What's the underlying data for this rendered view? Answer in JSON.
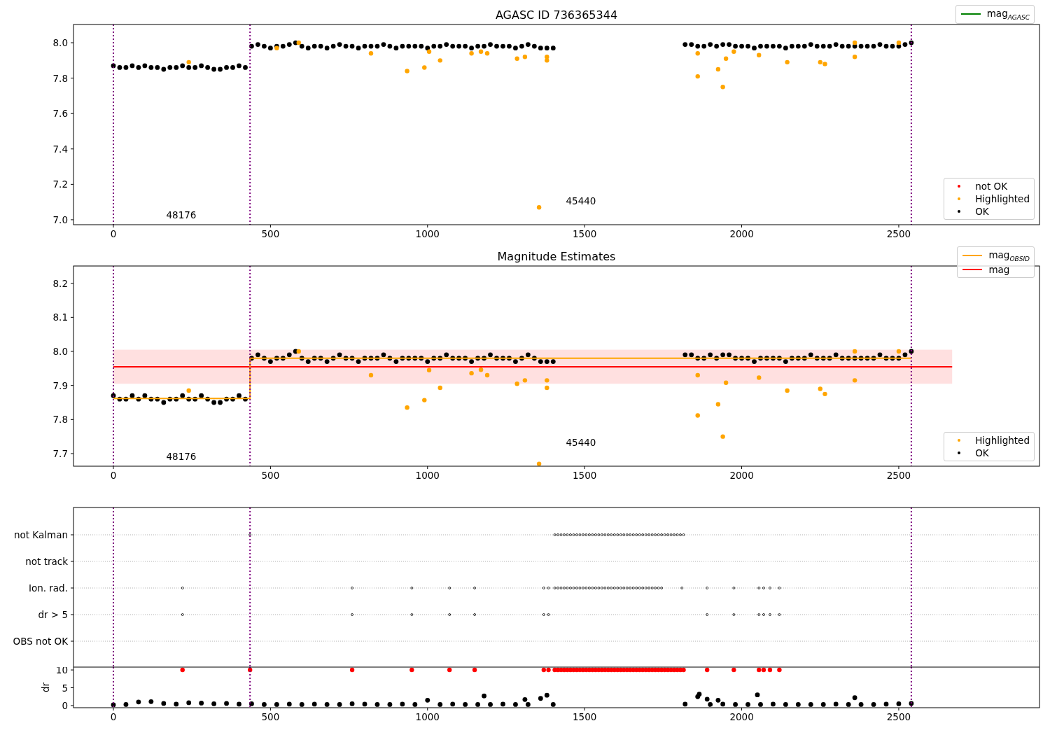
{
  "panels": [
    {
      "chart_data": {
        "type": "scatter",
        "title": "AGASC ID 736365344",
        "xlim": [
          -127,
          2948
        ],
        "ylim": [
          6.972,
          8.103
        ],
        "xticks": [
          0,
          500,
          1000,
          1500,
          2000,
          2500
        ],
        "yticks": [
          {
            "value": 7.0,
            "label": "7.0"
          },
          {
            "value": 7.2,
            "label": "7.2"
          },
          {
            "value": 7.4,
            "label": "7.4"
          },
          {
            "value": 7.6,
            "label": "7.6"
          },
          {
            "value": 7.8,
            "label": "7.8"
          },
          {
            "value": 8.0,
            "label": "8.0"
          }
        ],
        "series": [
          {
            "color": "#000000",
            "x": [
              0,
              20,
              40,
              60,
              80,
              100,
              120,
              140,
              160,
              180,
              200,
              220,
              240,
              260,
              280,
              300,
              320,
              340,
              360,
              380,
              400,
              420,
              440,
              460,
              480,
              500,
              520,
              540,
              560,
              580,
              600,
              620,
              640,
              660,
              680,
              700,
              720,
              740,
              760,
              780,
              800,
              820,
              840,
              860,
              880,
              900,
              920,
              940,
              960,
              980,
              1000,
              1020,
              1040,
              1060,
              1080,
              1100,
              1120,
              1140,
              1160,
              1180,
              1200,
              1220,
              1240,
              1260,
              1280,
              1300,
              1320,
              1340,
              1360,
              1380,
              1400,
              1820,
              1840,
              1860,
              1880,
              1900,
              1920,
              1940,
              1960,
              1980,
              2000,
              2020,
              2040,
              2060,
              2080,
              2100,
              2120,
              2140,
              2160,
              2180,
              2200,
              2220,
              2240,
              2260,
              2280,
              2300,
              2320,
              2340,
              2360,
              2380,
              2400,
              2420,
              2440,
              2460,
              2480,
              2500,
              2520,
              2540
            ],
            "values": [
              7.87,
              7.86,
              7.86,
              7.87,
              7.86,
              7.87,
              7.86,
              7.86,
              7.85,
              7.86,
              7.86,
              7.87,
              7.86,
              7.86,
              7.87,
              7.86,
              7.85,
              7.85,
              7.86,
              7.86,
              7.87,
              7.86,
              7.98,
              7.99,
              7.98,
              7.97,
              7.98,
              7.98,
              7.99,
              8.0,
              7.98,
              7.97,
              7.98,
              7.98,
              7.97,
              7.98,
              7.99,
              7.98,
              7.98,
              7.97,
              7.98,
              7.98,
              7.98,
              7.99,
              7.98,
              7.97,
              7.98,
              7.98,
              7.98,
              7.98,
              7.97,
              7.98,
              7.98,
              7.99,
              7.98,
              7.98,
              7.98,
              7.97,
              7.98,
              7.98,
              7.99,
              7.98,
              7.98,
              7.98,
              7.97,
              7.98,
              7.99,
              7.98,
              7.97,
              7.97,
              7.97,
              7.99,
              7.99,
              7.98,
              7.98,
              7.99,
              7.98,
              7.99,
              7.99,
              7.98,
              7.98,
              7.98,
              7.97,
              7.98,
              7.98,
              7.98,
              7.98,
              7.97,
              7.98,
              7.98,
              7.98,
              7.99,
              7.98,
              7.98,
              7.98,
              7.99,
              7.98,
              7.98,
              7.98,
              7.98,
              7.98,
              7.98,
              7.99,
              7.98,
              7.98,
              7.98,
              7.99,
              8.0
            ]
          },
          {
            "color": "#ffa500",
            "x": [
              240,
              520,
              590,
              820,
              935,
              990,
              1005,
              1040,
              1140,
              1170,
              1190,
              1285,
              1310,
              1355,
              1380,
              1380,
              1860,
              1860,
              1925,
              1940,
              1950,
              1975,
              2055,
              2145,
              2250,
              2265,
              2360,
              2360,
              2500
            ],
            "values": [
              7.89,
              7.97,
              8.0,
              7.94,
              7.84,
              7.86,
              7.95,
              7.9,
              7.94,
              7.95,
              7.94,
              7.91,
              7.92,
              7.07,
              7.9,
              7.92,
              7.81,
              7.94,
              7.85,
              7.75,
              7.91,
              7.95,
              7.93,
              7.89,
              7.89,
              7.88,
              7.92,
              8.0,
              8.0
            ]
          }
        ],
        "ref_lines": [
          {
            "axis": "x",
            "value": 0
          },
          {
            "axis": "x",
            "value": 435
          },
          {
            "axis": "x",
            "value": 2540
          }
        ],
        "annotations": [
          "48176",
          "45440"
        ]
      },
      "legends": [
        {
          "entries": [
            {
              "label": "mag$_{AGASC}$",
              "color": "#008000",
              "kind": "line"
            }
          ]
        },
        {
          "entries": [
            {
              "label": "not OK",
              "color": "#ff0000",
              "kind": "dot"
            },
            {
              "label": "Highlighted",
              "color": "#ffa500",
              "kind": "dot"
            },
            {
              "label": "OK",
              "color": "#000000",
              "kind": "dot"
            }
          ]
        }
      ]
    },
    {
      "chart_data": {
        "type": "scatter",
        "title": "Magnitude Estimates",
        "xlim": [
          -127,
          2948
        ],
        "ylim": [
          7.663,
          8.2507
        ],
        "xticks": [
          0,
          500,
          1000,
          1500,
          2000,
          2500
        ],
        "yticks": [
          {
            "value": 7.7,
            "label": "7.7"
          },
          {
            "value": 7.8,
            "label": "7.8"
          },
          {
            "value": 7.9,
            "label": "7.9"
          },
          {
            "value": 8.0,
            "label": "8.0"
          },
          {
            "value": 8.1,
            "label": "8.1"
          },
          {
            "value": 8.2,
            "label": "8.2"
          }
        ],
        "series": [
          {
            "color": "#ff0000",
            "type": "line",
            "x": [
              0,
              2670
            ],
            "values": [
              7.955,
              7.955
            ]
          },
          {
            "color": "#000000",
            "x": [
              0,
              20,
              40,
              60,
              80,
              100,
              120,
              140,
              160,
              180,
              200,
              220,
              240,
              260,
              280,
              300,
              320,
              340,
              360,
              380,
              400,
              420,
              440,
              460,
              480,
              500,
              520,
              540,
              560,
              580,
              600,
              620,
              640,
              660,
              680,
              700,
              720,
              740,
              760,
              780,
              800,
              820,
              840,
              860,
              880,
              900,
              920,
              940,
              960,
              980,
              1000,
              1020,
              1040,
              1060,
              1080,
              1100,
              1120,
              1140,
              1160,
              1180,
              1200,
              1220,
              1240,
              1260,
              1280,
              1300,
              1320,
              1340,
              1360,
              1380,
              1400,
              1820,
              1840,
              1860,
              1880,
              1900,
              1920,
              1940,
              1960,
              1980,
              2000,
              2020,
              2040,
              2060,
              2080,
              2100,
              2120,
              2140,
              2160,
              2180,
              2200,
              2220,
              2240,
              2260,
              2280,
              2300,
              2320,
              2340,
              2360,
              2380,
              2400,
              2420,
              2440,
              2460,
              2480,
              2500,
              2520,
              2540
            ],
            "values": [
              7.87,
              7.86,
              7.86,
              7.87,
              7.86,
              7.87,
              7.86,
              7.86,
              7.85,
              7.86,
              7.86,
              7.87,
              7.86,
              7.86,
              7.87,
              7.86,
              7.85,
              7.85,
              7.86,
              7.86,
              7.87,
              7.86,
              7.98,
              7.99,
              7.98,
              7.97,
              7.98,
              7.98,
              7.99,
              8.0,
              7.98,
              7.97,
              7.98,
              7.98,
              7.97,
              7.98,
              7.99,
              7.98,
              7.98,
              7.97,
              7.98,
              7.98,
              7.98,
              7.99,
              7.98,
              7.97,
              7.98,
              7.98,
              7.98,
              7.98,
              7.97,
              7.98,
              7.98,
              7.99,
              7.98,
              7.98,
              7.98,
              7.97,
              7.98,
              7.98,
              7.99,
              7.98,
              7.98,
              7.98,
              7.97,
              7.98,
              7.99,
              7.98,
              7.97,
              7.97,
              7.97,
              7.99,
              7.99,
              7.98,
              7.98,
              7.99,
              7.98,
              7.99,
              7.99,
              7.98,
              7.98,
              7.98,
              7.97,
              7.98,
              7.98,
              7.98,
              7.98,
              7.97,
              7.98,
              7.98,
              7.98,
              7.99,
              7.98,
              7.98,
              7.98,
              7.99,
              7.98,
              7.98,
              7.98,
              7.98,
              7.98,
              7.98,
              7.99,
              7.98,
              7.98,
              7.98,
              7.99,
              8.0
            ]
          },
          {
            "color": "#ffa500",
            "type": "line",
            "x": [
              0,
              435,
              435,
              2540
            ],
            "values": [
              7.862,
              7.862,
              7.98,
              7.98
            ]
          },
          {
            "color": "#ffa500",
            "x": [
              240,
              590,
              820,
              935,
              990,
              1005,
              1040,
              1140,
              1170,
              1190,
              1285,
              1310,
              1355,
              1380,
              1380,
              1860,
              1860,
              1925,
              1940,
              1950,
              2055,
              2145,
              2250,
              2265,
              2360,
              2360,
              2500
            ],
            "values": [
              7.885,
              8.0,
              7.93,
              7.835,
              7.857,
              7.945,
              7.893,
              7.936,
              7.946,
              7.93,
              7.905,
              7.915,
              7.67,
              7.893,
              7.915,
              7.812,
              7.93,
              7.845,
              7.75,
              7.908,
              7.923,
              7.885,
              7.89,
              7.875,
              7.915,
              8.0,
              8.0
            ]
          }
        ],
        "bands": [
          {
            "axis": "y",
            "from": 7.905,
            "to": 8.005,
            "color": "#ff0000"
          }
        ],
        "ref_lines": [
          {
            "axis": "x",
            "value": 0
          },
          {
            "axis": "x",
            "value": 435
          },
          {
            "axis": "x",
            "value": 2540
          }
        ],
        "annotations": [
          "48176",
          "45440"
        ]
      },
      "legends": [
        {
          "entries": [
            {
              "label": "mag$_{OBSID}$",
              "color": "#ffa500",
              "kind": "line"
            },
            {
              "label": "mag",
              "color": "#ff0000",
              "kind": "line"
            }
          ]
        },
        {
          "entries": [
            {
              "label": "Highlighted",
              "color": "#ffa500",
              "kind": "dot"
            },
            {
              "label": "OK",
              "color": "#000000",
              "kind": "dot"
            }
          ]
        }
      ]
    },
    {
      "flag_rows": [
        "not Kalman",
        "not track",
        "Ion. rad.",
        "dr > 5",
        "OBS not OK"
      ]
    },
    {
      "chart_data": {
        "type": "scatter",
        "ylabel": "dr",
        "xlim": [
          -127,
          2948
        ],
        "ylim": [
          -0.6,
          10.8
        ],
        "xticks": [
          0,
          500,
          1000,
          1500,
          2000,
          2500
        ],
        "yticks": [
          0,
          5,
          10
        ],
        "series": [
          {
            "color": "#000000",
            "x": [
              0,
              40,
              80,
              120,
              160,
              200,
              240,
              280,
              320,
              360,
              400,
              440,
              480,
              520,
              560,
              600,
              640,
              680,
              720,
              760,
              800,
              840,
              880,
              920,
              960,
              1000,
              1040,
              1080,
              1120,
              1160,
              1180,
              1200,
              1240,
              1280,
              1310,
              1320,
              1360,
              1380,
              1400,
              1820,
              1860,
              1865,
              1890,
              1900,
              1925,
              1940,
              1980,
              2020,
              2050,
              2060,
              2100,
              2140,
              2180,
              2220,
              2260,
              2300,
              2340,
              2360,
              2380,
              2420,
              2460,
              2500,
              2540
            ],
            "values": [
              0.2,
              0.3,
              1.0,
              1.1,
              0.6,
              0.4,
              0.8,
              0.7,
              0.5,
              0.6,
              0.4,
              0.5,
              0.3,
              0.3,
              0.4,
              0.3,
              0.4,
              0.3,
              0.3,
              0.5,
              0.4,
              0.3,
              0.3,
              0.4,
              0.3,
              1.5,
              0.3,
              0.4,
              0.3,
              0.3,
              2.7,
              0.3,
              0.4,
              0.3,
              1.7,
              0.3,
              2.0,
              2.9,
              0.3,
              0.4,
              2.5,
              3.2,
              1.8,
              0.3,
              1.5,
              0.4,
              0.3,
              0.3,
              3.0,
              0.3,
              0.4,
              0.3,
              0.3,
              0.3,
              0.3,
              0.4,
              0.3,
              2.2,
              0.3,
              0.3,
              0.4,
              0.5,
              0.6
            ]
          },
          {
            "color": "#ff0000",
            "x": [
              220,
              435,
              760,
              950,
              1070,
              1150,
              1370,
              1385,
              1405,
              1415,
              1425,
              1435,
              1445,
              1455,
              1465,
              1475,
              1485,
              1495,
              1505,
              1515,
              1525,
              1535,
              1545,
              1555,
              1565,
              1575,
              1585,
              1595,
              1605,
              1615,
              1625,
              1635,
              1645,
              1655,
              1665,
              1675,
              1685,
              1695,
              1705,
              1715,
              1725,
              1735,
              1745,
              1755,
              1765,
              1775,
              1785,
              1795,
              1805,
              1815,
              1890,
              1975,
              2055,
              2070,
              2090,
              2120
            ],
            "values": [
              10,
              10,
              10,
              10,
              10,
              10,
              10,
              10,
              10,
              10,
              10,
              10,
              10,
              10,
              10,
              10,
              10,
              10,
              10,
              10,
              10,
              10,
              10,
              10,
              10,
              10,
              10,
              10,
              10,
              10,
              10,
              10,
              10,
              10,
              10,
              10,
              10,
              10,
              10,
              10,
              10,
              10,
              10,
              10,
              10,
              10,
              10,
              10,
              10,
              10,
              10,
              10,
              10,
              10,
              10,
              10
            ]
          }
        ],
        "ref_lines": [
          {
            "axis": "x",
            "value": 0
          },
          {
            "axis": "x",
            "value": 435
          },
          {
            "axis": "x",
            "value": 2540
          }
        ]
      }
    }
  ]
}
